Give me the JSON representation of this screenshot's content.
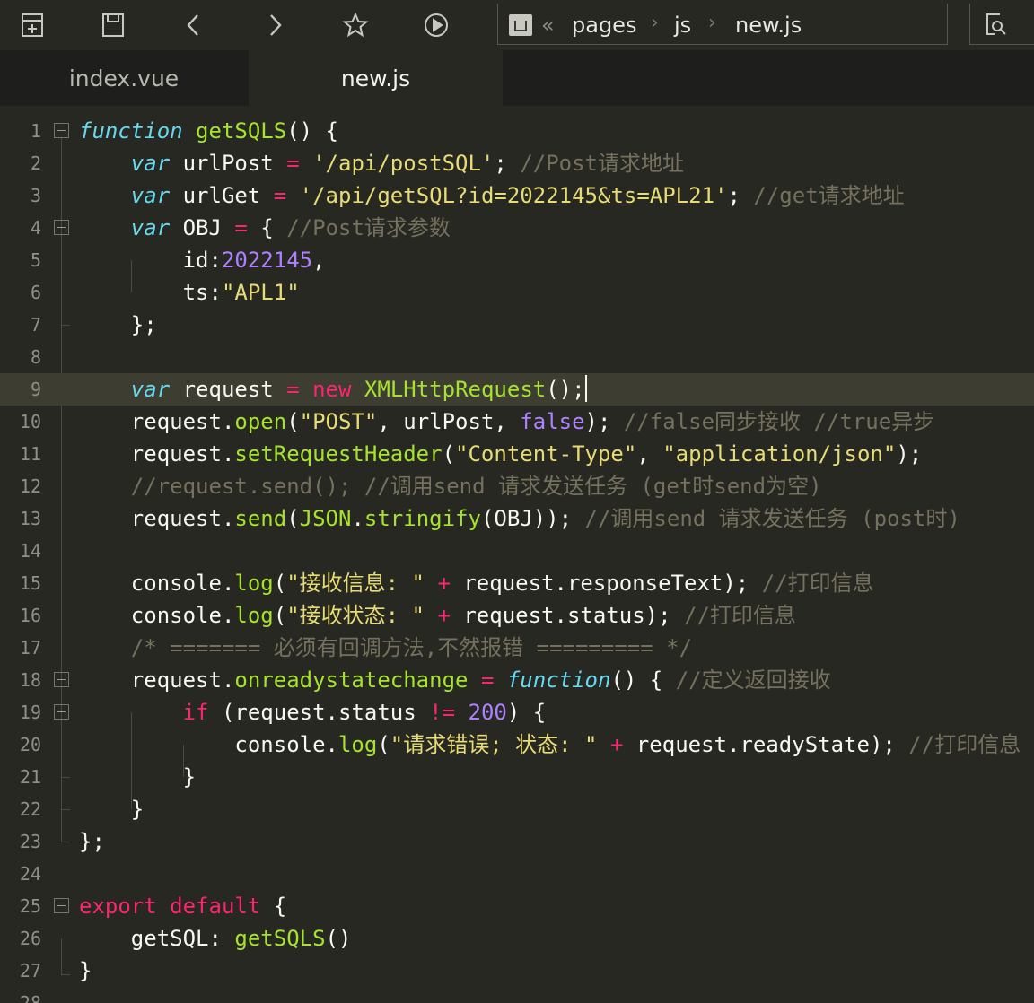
{
  "breadcrumb": {
    "items": [
      "pages",
      "js",
      "new.js"
    ],
    "back": "«",
    "sep": "›"
  },
  "tabs": [
    {
      "label": "index.vue"
    },
    {
      "label": "new.js"
    }
  ],
  "icons": {
    "toolbar": [
      "new-file-icon",
      "save-icon",
      "back-arrow-icon",
      "forward-arrow-icon",
      "star-icon",
      "play-icon",
      "search-file-icon"
    ]
  },
  "editor": {
    "current_line": 9,
    "lines": [
      [
        [
          "kw",
          "function"
        ],
        [
          "pl",
          " "
        ],
        [
          "fn",
          "getSQLS"
        ],
        [
          "pl",
          "() {"
        ]
      ],
      [
        [
          "pl",
          "    "
        ],
        [
          "kw",
          "var"
        ],
        [
          "pl",
          " urlPost "
        ],
        [
          "op",
          "="
        ],
        [
          "pl",
          " "
        ],
        [
          "str",
          "'/api/postSQL'"
        ],
        [
          "pl",
          "; "
        ],
        [
          "cm",
          "//Post请求地址"
        ]
      ],
      [
        [
          "pl",
          "    "
        ],
        [
          "kw",
          "var"
        ],
        [
          "pl",
          " urlGet "
        ],
        [
          "op",
          "="
        ],
        [
          "pl",
          " "
        ],
        [
          "str",
          "'/api/getSQL?id=2022145&ts=APL21'"
        ],
        [
          "pl",
          "; "
        ],
        [
          "cm",
          "//get请求地址"
        ]
      ],
      [
        [
          "pl",
          "    "
        ],
        [
          "kw",
          "var"
        ],
        [
          "pl",
          " OBJ "
        ],
        [
          "op",
          "="
        ],
        [
          "pl",
          " { "
        ],
        [
          "cm",
          "//Post请求参数"
        ]
      ],
      [
        [
          "pl",
          "        id:"
        ],
        [
          "num",
          "2022145"
        ],
        [
          "pl",
          ","
        ]
      ],
      [
        [
          "pl",
          "        ts:"
        ],
        [
          "str",
          "\"APL1\""
        ]
      ],
      [
        [
          "pl",
          "    };"
        ]
      ],
      [],
      [
        [
          "pl",
          "    "
        ],
        [
          "kw",
          "var"
        ],
        [
          "pl",
          " request "
        ],
        [
          "op",
          "="
        ],
        [
          "pl",
          " "
        ],
        [
          "op",
          "new"
        ],
        [
          "pl",
          " "
        ],
        [
          "fn",
          "XMLHttpRequest"
        ],
        [
          "pl",
          "();"
        ]
      ],
      [
        [
          "pl",
          "    request."
        ],
        [
          "fn",
          "open"
        ],
        [
          "pl",
          "("
        ],
        [
          "str",
          "\"POST\""
        ],
        [
          "pl",
          ", urlPost, "
        ],
        [
          "num",
          "false"
        ],
        [
          "pl",
          "); "
        ],
        [
          "cm",
          "//false同步接收 //true异步"
        ]
      ],
      [
        [
          "pl",
          "    request."
        ],
        [
          "fn",
          "setRequestHeader"
        ],
        [
          "pl",
          "("
        ],
        [
          "str",
          "\"Content-Type\""
        ],
        [
          "pl",
          ", "
        ],
        [
          "str",
          "\"application/json\""
        ],
        [
          "pl",
          ");"
        ]
      ],
      [
        [
          "pl",
          "    "
        ],
        [
          "cm",
          "//request.send(); //调用send 请求发送任务 (get时send为空)"
        ]
      ],
      [
        [
          "pl",
          "    request."
        ],
        [
          "fn",
          "send"
        ],
        [
          "pl",
          "("
        ],
        [
          "fn",
          "JSON"
        ],
        [
          "pl",
          "."
        ],
        [
          "fn",
          "stringify"
        ],
        [
          "pl",
          "(OBJ)); "
        ],
        [
          "cm",
          "//调用send 请求发送任务 (post时)"
        ]
      ],
      [],
      [
        [
          "pl",
          "    console."
        ],
        [
          "fn",
          "log"
        ],
        [
          "pl",
          "("
        ],
        [
          "str",
          "\"接收信息: \""
        ],
        [
          "pl",
          " "
        ],
        [
          "op",
          "+"
        ],
        [
          "pl",
          " request.responseText); "
        ],
        [
          "cm",
          "//打印信息"
        ]
      ],
      [
        [
          "pl",
          "    console."
        ],
        [
          "fn",
          "log"
        ],
        [
          "pl",
          "("
        ],
        [
          "str",
          "\"接收状态: \""
        ],
        [
          "pl",
          " "
        ],
        [
          "op",
          "+"
        ],
        [
          "pl",
          " request.status); "
        ],
        [
          "cm",
          "//打印信息"
        ]
      ],
      [
        [
          "pl",
          "    "
        ],
        [
          "cm",
          "/* ======= 必须有回调方法,不然报错 ========= */"
        ]
      ],
      [
        [
          "pl",
          "    request."
        ],
        [
          "fn",
          "onreadystatechange"
        ],
        [
          "pl",
          " "
        ],
        [
          "op",
          "="
        ],
        [
          "pl",
          " "
        ],
        [
          "kw",
          "function"
        ],
        [
          "pl",
          "() { "
        ],
        [
          "cm",
          "//定义返回接收"
        ]
      ],
      [
        [
          "pl",
          "        "
        ],
        [
          "op",
          "if"
        ],
        [
          "pl",
          " (request.status "
        ],
        [
          "op",
          "!="
        ],
        [
          "pl",
          " "
        ],
        [
          "num",
          "200"
        ],
        [
          "pl",
          ") {"
        ]
      ],
      [
        [
          "pl",
          "            console."
        ],
        [
          "fn",
          "log"
        ],
        [
          "pl",
          "("
        ],
        [
          "str",
          "\"请求错误; 状态: \""
        ],
        [
          "pl",
          " "
        ],
        [
          "op",
          "+"
        ],
        [
          "pl",
          " request.readyState); "
        ],
        [
          "cm",
          "//打印信息"
        ]
      ],
      [
        [
          "pl",
          "        }"
        ]
      ],
      [
        [
          "pl",
          "    }"
        ]
      ],
      [
        [
          "pl",
          "};"
        ]
      ],
      [],
      [
        [
          "op",
          "export"
        ],
        [
          "pl",
          " "
        ],
        [
          "op",
          "default"
        ],
        [
          "pl",
          " {"
        ]
      ],
      [
        [
          "pl",
          "    getSQL: "
        ],
        [
          "fn",
          "getSQLS"
        ],
        [
          "pl",
          "()"
        ]
      ],
      [
        [
          "pl",
          "}"
        ]
      ],
      []
    ]
  }
}
